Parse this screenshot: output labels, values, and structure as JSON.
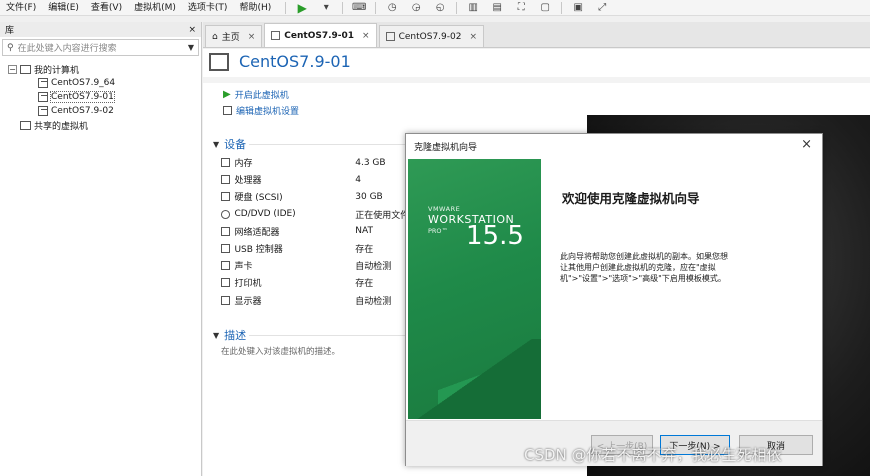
{
  "menu": {
    "items": [
      "文件(F)",
      "编辑(E)",
      "查看(V)",
      "虚拟机(M)",
      "选项卡(T)",
      "帮助(H)"
    ]
  },
  "library": {
    "title": "库",
    "close": "×",
    "search_placeholder": "在此处键入内容进行搜索",
    "tree": {
      "root": "我的计算机",
      "children": [
        "CentOS7.9_64",
        "CentOS7.9-01",
        "CentOS7.9-02"
      ],
      "shared": "共享的虚拟机"
    }
  },
  "tabs": [
    {
      "label": "主页",
      "close": "×"
    },
    {
      "label": "CentOS7.9-01",
      "close": "×"
    },
    {
      "label": "CentOS7.9-02",
      "close": "×"
    }
  ],
  "main": {
    "title": "CentOS7.9-01",
    "actions": [
      "开启此虚拟机",
      "编辑虚拟机设置"
    ],
    "devices_title": "设备",
    "devices": [
      {
        "name": "内存",
        "value": "4.3 GB",
        "icon": "memory-icon"
      },
      {
        "name": "处理器",
        "value": "4",
        "icon": "cpu-icon"
      },
      {
        "name": "硬盘 (SCSI)",
        "value": "30 GB",
        "icon": "disk-icon"
      },
      {
        "name": "CD/DVD (IDE)",
        "value": "正在使用文件",
        "icon": "cd-icon"
      },
      {
        "name": "网络适配器",
        "value": "NAT",
        "icon": "network-icon"
      },
      {
        "name": "USB 控制器",
        "value": "存在",
        "icon": "usb-icon"
      },
      {
        "name": "声卡",
        "value": "自动检测",
        "icon": "sound-icon"
      },
      {
        "name": "打印机",
        "value": "存在",
        "icon": "printer-icon"
      },
      {
        "name": "显示器",
        "value": "自动检测",
        "icon": "display-icon"
      }
    ],
    "description_title": "描述",
    "description_hint": "在此处键入对该虚拟机的描述。"
  },
  "dialog": {
    "title": "克隆虚拟机向导",
    "close": "×",
    "brand_line1": "VMWARE",
    "brand_line2": "WORKSTATION",
    "brand_line3": "PRO™",
    "brand_version": "15.5",
    "heading": "欢迎使用克隆虚拟机向导",
    "body": "此向导将帮助您创建此虚拟机的副本。如果您想让其他用户创建此虚拟机的克隆，应在\"虚拟机\">\"设置\">\"选项\">\"高级\"下启用模板模式。",
    "back_label": "< 上一步(B)",
    "next_label": "下一步(N) >",
    "cancel_label": "取消"
  },
  "watermark": "CSDN @你若不离不弃，我必生死相依",
  "colors": {
    "link_blue": "#1c64b4",
    "banner_green": "#1f8a49",
    "play_green": "#2a9d2a"
  }
}
